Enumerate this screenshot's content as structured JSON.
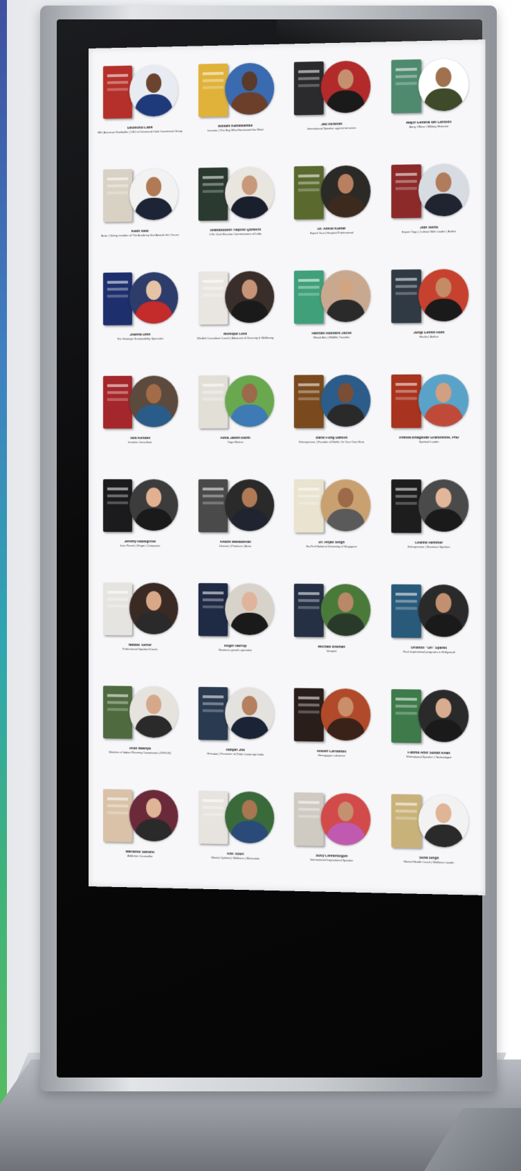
{
  "scene": {
    "accent_strip_colors": [
      "#3f4fa0",
      "#2fa6b0",
      "#5bbf5a"
    ],
    "frame_color": "#c9ccd0",
    "bezel_color": "#0a0a0b",
    "screen_background": "#f7f7f9"
  },
  "speakers": [
    {
      "name": "Desmond Clark",
      "role": "NFL American Footballer | CEO of Desmond Clark Investment Group",
      "book_color": "#b5302a",
      "bg_color": "#e8ecf2",
      "suit_color": "#1f3a7a",
      "skin_color": "#6b4430"
    },
    {
      "name": "William Kamkwamba",
      "role": "Inventor | The Boy Who Harnessed the Wind",
      "book_color": "#e0b23a",
      "bg_color": "#3a6ab0",
      "suit_color": "#6b3f2a",
      "skin_color": "#5a3a28"
    },
    {
      "name": "Jad Abrahim",
      "role": "International Speaker against terrorism",
      "book_color": "#2b2b2e",
      "bg_color": "#b22a2a",
      "suit_color": "#1a1a1a",
      "skin_color": "#c49070"
    },
    {
      "name": "Major General Ian Cardozo",
      "role": "Army Officer | Military Historian",
      "book_color": "#4f8a6e",
      "bg_color": "#ffffff",
      "suit_color": "#3e4a2a",
      "skin_color": "#a0714e"
    },
    {
      "name": "Kabir Bedi",
      "role": "Actor | Voting member of The Academy that Awards the Oscars",
      "book_color": "#d9d2c4",
      "bg_color": "#f2f2f2",
      "suit_color": "#1c2436",
      "skin_color": "#b07a55"
    },
    {
      "name": "Shahabuddin Yaqoob Quraishi",
      "role": "17th Chief Election Commissioner of India",
      "book_color": "#2a3a30",
      "bg_color": "#e9e5df",
      "suit_color": "#1a1f2e",
      "skin_color": "#c7987a"
    },
    {
      "name": "Dr. Amrut Kumar",
      "role": "Expert Tour | Hospital Professional",
      "book_color": "#5a6a2f",
      "bg_color": "#2c2a26",
      "suit_color": "#3d2a1f",
      "skin_color": "#b88060"
    },
    {
      "name": "Jubi Sidhu",
      "role": "Expert Yoga | Cultural Sikh Leader | Author",
      "book_color": "#8c2a2a",
      "bg_color": "#d7dbe2",
      "suit_color": "#1f2430",
      "skin_color": "#b07c5c"
    },
    {
      "name": "Joanna Dinn",
      "role": "The Strategic Sustainability Specialist",
      "book_color": "#1e2f6e",
      "bg_color": "#2d3c6a",
      "suit_color": "#c42b2b",
      "skin_color": "#e6c2a6"
    },
    {
      "name": "Monique Leila",
      "role": "Mindful Consultant Coach | Advocate of Diversity & Wellbeing",
      "book_color": "#e9e6e1",
      "bg_color": "#3a2e2a",
      "suit_color": "#1a1a1a",
      "skin_color": "#c89478"
    },
    {
      "name": "Hannah Hubbard Jacob",
      "role": "Mixed Arts | Wildlife Traveller",
      "book_color": "#3fa07a",
      "bg_color": "#c9a890",
      "suit_color": "#2a2a2a",
      "skin_color": "#d2a582"
    },
    {
      "name": "Jungi Gethin Hunt",
      "role": "Healer | Author",
      "book_color": "#303a44",
      "bg_color": "#c7412f",
      "suit_color": "#1a1a1a",
      "skin_color": "#c48b66"
    },
    {
      "name": "Tara Kendell",
      "role": "Intuitive Consultant",
      "book_color": "#a4272b",
      "bg_color": "#5c4a3e",
      "suit_color": "#2a5c8a",
      "skin_color": "#a36c48"
    },
    {
      "name": "Alma Jafeth Barth",
      "role": "Yoga Mentor",
      "book_color": "#e2dfd7",
      "bg_color": "#6aa84f",
      "suit_color": "#3e7ab3",
      "skin_color": "#9b6a4a"
    },
    {
      "name": "Barbi Fung Damon",
      "role": "Entrepreneur | Founder of Bottle On Your Own Hero",
      "book_color": "#7a4a1e",
      "bg_color": "#2b5c8a",
      "suit_color": "#2a2a2a",
      "skin_color": "#7a4e34"
    },
    {
      "name": "Anthea Bhagavati Grandvishe, PhD",
      "role": "Spiritual Leader",
      "book_color": "#a8331e",
      "bg_color": "#5aa3c8",
      "suit_color": "#c04a3a",
      "skin_color": "#d0a080"
    },
    {
      "name": "Jeremy Hazelgrove",
      "role": "Jazz Pianist | Singer | Composer",
      "book_color": "#1b1b1e",
      "bg_color": "#3c3c3c",
      "suit_color": "#1a1a1a",
      "skin_color": "#e0b090"
    },
    {
      "name": "Anunit Mahadevan",
      "role": "Director | Producer | Actor",
      "book_color": "#4a4a4a",
      "bg_color": "#2a2a2a",
      "suit_color": "#1f2430",
      "skin_color": "#b07a55"
    },
    {
      "name": "Dr. Anjali Singh",
      "role": "Ex-Prof National University of Singapore",
      "book_color": "#e9e3cf",
      "bg_color": "#c9a070",
      "suit_color": "#5a5a5a",
      "skin_color": "#9c6a48"
    },
    {
      "name": "Leanne Hemmer",
      "role": "Entrepreneur | Business Speaker",
      "book_color": "#1d1d1d",
      "bg_color": "#4a4a4a",
      "suit_color": "#1a1a1a",
      "skin_color": "#e2b698"
    },
    {
      "name": "Natalie Turner",
      "role": "Professional Speaker/Coach",
      "book_color": "#e6e4e1",
      "bg_color": "#3a2a24",
      "suit_color": "#2a2a2a",
      "skin_color": "#d9a888"
    },
    {
      "name": "Roger Harrop",
      "role": "Business growth specialist",
      "book_color": "#1f2a44",
      "bg_color": "#d7d2ca",
      "suit_color": "#1a1a1a",
      "skin_color": "#e0b49a"
    },
    {
      "name": "Michael Bramah",
      "role": "Vampire",
      "book_color": "#253044",
      "bg_color": "#4a7a3a",
      "suit_color": "#2a3a2a",
      "skin_color": "#b88868"
    },
    {
      "name": "Orlando \"Ori\" Sparks",
      "role": "Real inspirational programs in Hollywood",
      "book_color": "#2a5a7a",
      "bg_color": "#2a2a2a",
      "suit_color": "#1a1a1a",
      "skin_color": "#c29070"
    },
    {
      "name": "Arun Malviya",
      "role": "Member of Indian Planning Commission (1998-99)",
      "book_color": "#4f6a3f",
      "bg_color": "#e6e3de",
      "suit_color": "#2a2a2a",
      "skin_color": "#d6a88a"
    },
    {
      "name": "Ranjan Jha",
      "role": "Historian | Presenter of Pride Campaign India",
      "book_color": "#2a3a50",
      "bg_color": "#e4e2de",
      "suit_color": "#1a2436",
      "skin_color": "#b48060"
    },
    {
      "name": "Robert Cervantes",
      "role": "Newspaper columnist",
      "book_color": "#2a1e1a",
      "bg_color": "#b04a2a",
      "suit_color": "#3a2218",
      "skin_color": "#c98f68"
    },
    {
      "name": "Fatima Amir Sultan Khan",
      "role": "Motivational Speaker | Technologist",
      "book_color": "#3e7a4a",
      "bg_color": "#2a2a2a",
      "suit_color": "#1a1a1a",
      "skin_color": "#d8ac8e"
    },
    {
      "name": "Marianne Sandho",
      "role": "Addiction Counsellor",
      "book_color": "#d9c2a8",
      "bg_color": "#6a2a3a",
      "suit_color": "#2a2a2a",
      "skin_color": "#e0b496"
    },
    {
      "name": "Anil Tuluri",
      "role": "Mental Optimist | Wellness | Motivation",
      "book_color": "#e7e4df",
      "bg_color": "#3a6a3a",
      "suit_color": "#2a4a7a",
      "skin_color": "#a87650"
    },
    {
      "name": "Susy Lehnerbogen",
      "role": "International Inspirational Speaker",
      "book_color": "#cfcac2",
      "bg_color": "#d34a4a",
      "suit_color": "#c05ab0",
      "skin_color": "#c49070"
    },
    {
      "name": "Suna Singh",
      "role": "Mental Health Coach | Wellness Leader",
      "book_color": "#c9b27a",
      "bg_color": "#f2f2f2",
      "suit_color": "#2a2a2a",
      "skin_color": "#e0b496"
    }
  ]
}
